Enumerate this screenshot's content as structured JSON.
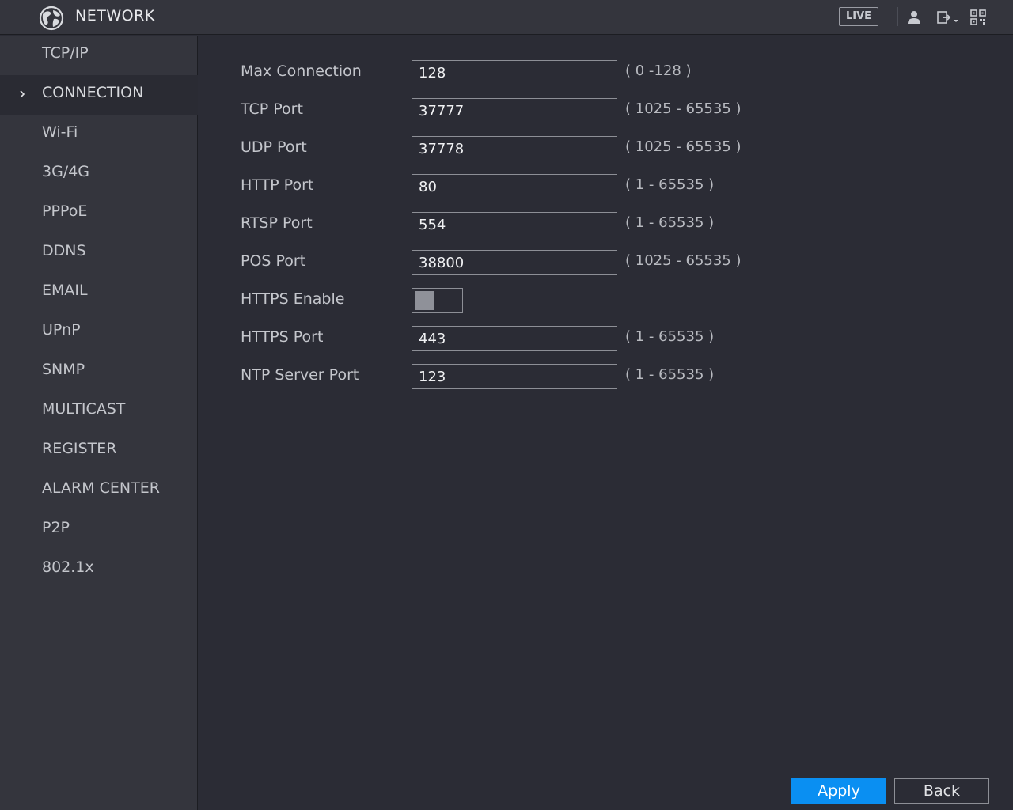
{
  "header": {
    "title": "NETWORK",
    "live_label": "LIVE",
    "icons": [
      "user-icon",
      "logout-icon",
      "qr-code-icon"
    ]
  },
  "sidebar": {
    "items": [
      {
        "label": "TCP/IP"
      },
      {
        "label": "CONNECTION",
        "active": true
      },
      {
        "label": "Wi-Fi"
      },
      {
        "label": "3G/4G"
      },
      {
        "label": "PPPoE"
      },
      {
        "label": "DDNS"
      },
      {
        "label": "EMAIL"
      },
      {
        "label": "UPnP"
      },
      {
        "label": "SNMP"
      },
      {
        "label": "MULTICAST"
      },
      {
        "label": "REGISTER"
      },
      {
        "label": "ALARM CENTER"
      },
      {
        "label": "P2P"
      },
      {
        "label": "802.1x"
      }
    ]
  },
  "form": {
    "max_connection": {
      "label": "Max Connection",
      "value": "128",
      "range": "( 0 -128 )"
    },
    "tcp_port": {
      "label": "TCP Port",
      "value": "37777",
      "range": "( 1025 - 65535 )"
    },
    "udp_port": {
      "label": "UDP Port",
      "value": "37778",
      "range": "( 1025 - 65535 )"
    },
    "http_port": {
      "label": "HTTP Port",
      "value": "80",
      "range": "( 1 - 65535 )"
    },
    "rtsp_port": {
      "label": "RTSP Port",
      "value": "554",
      "range": "( 1 - 65535 )"
    },
    "pos_port": {
      "label": "POS Port",
      "value": "38800",
      "range": "( 1025 - 65535 )"
    },
    "https_enable": {
      "label": "HTTPS Enable",
      "enabled": false
    },
    "https_port": {
      "label": "HTTPS Port",
      "value": "443",
      "range": "( 1 - 65535 )"
    },
    "ntp_server_port": {
      "label": "NTP Server Port",
      "value": "123",
      "range": "( 1 - 65535 )"
    }
  },
  "footer": {
    "apply_label": "Apply",
    "back_label": "Back"
  },
  "colors": {
    "background": "#2b2c35",
    "panel": "#34353d",
    "accent": "#0a8ff2",
    "text": "#c4c6cc"
  }
}
